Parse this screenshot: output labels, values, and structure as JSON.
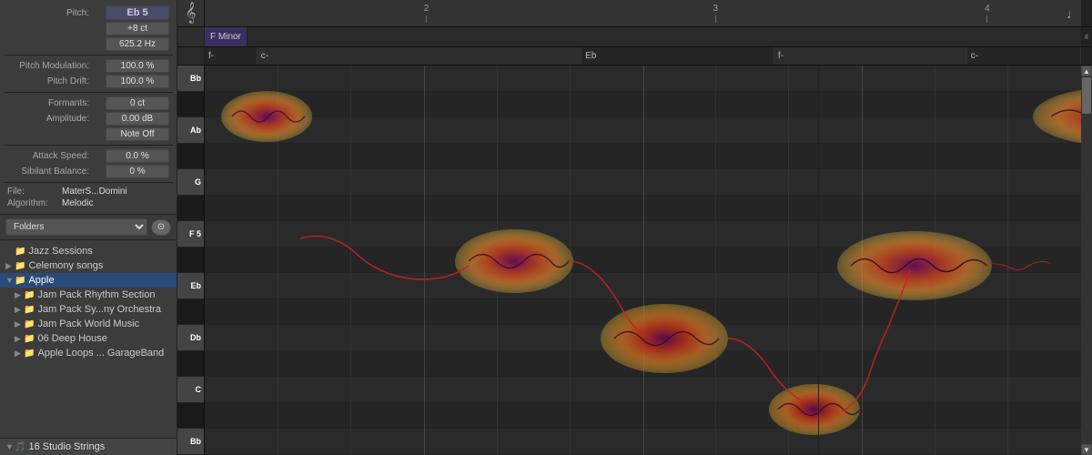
{
  "leftPanel": {
    "pitch_label": "Pitch:",
    "pitch_value": "Eb 5",
    "pitch_cents": "+8 ct",
    "pitch_hz": "625.2 Hz",
    "pitch_mod_label": "Pitch Modulation:",
    "pitch_mod_value": "100.0 %",
    "pitch_drift_label": "Pitch Drift:",
    "pitch_drift_value": "100.0 %",
    "formants_label": "Formants:",
    "formants_value": "0 ct",
    "amplitude_label": "Amplitude:",
    "amplitude_value": "0.00 dB",
    "note_off_label": "Note Off",
    "attack_speed_label": "Attack Speed:",
    "attack_speed_value": "0.0 %",
    "sibilant_balance_label": "Sibilant Balance:",
    "sibilant_balance_value": "0 %",
    "file_label": "File:",
    "file_value": "MaterS...Domini",
    "algorithm_label": "Algorithm:",
    "algorithm_value": "Melodic",
    "browser_select": "Folders",
    "tree": [
      {
        "label": "Jazz Sessions",
        "indent": 0,
        "arrow": "",
        "hasArrow": false,
        "selected": false
      },
      {
        "label": "Celemony songs",
        "indent": 0,
        "arrow": "▶",
        "hasArrow": true,
        "selected": false
      },
      {
        "label": "Apple",
        "indent": 0,
        "arrow": "▼",
        "hasArrow": true,
        "selected": true
      },
      {
        "label": "Jam Pack Rhythm Section",
        "indent": 1,
        "arrow": "▶",
        "hasArrow": true,
        "selected": false
      },
      {
        "label": "Jam Pack Sy...ny Orchestra",
        "indent": 1,
        "arrow": "▶",
        "hasArrow": true,
        "selected": false
      },
      {
        "label": "Jam Pack World Music",
        "indent": 1,
        "arrow": "▶",
        "hasArrow": true,
        "selected": false
      },
      {
        "label": "06 Deep House",
        "indent": 1,
        "arrow": "▶",
        "hasArrow": true,
        "selected": false
      },
      {
        "label": "Apple Loops ... GarageBand",
        "indent": 1,
        "arrow": "▶",
        "hasArrow": true,
        "selected": false
      }
    ],
    "bottom_item": "16 Studio Strings"
  },
  "editor": {
    "key_label": "F Minor",
    "ruler_marks": [
      "2",
      "3",
      "4"
    ],
    "chords": [
      "f-",
      "c-",
      "Eb",
      "f-",
      "c-"
    ],
    "piano_notes": [
      {
        "label": "Bb",
        "type": "white"
      },
      {
        "label": "",
        "type": "black"
      },
      {
        "label": "Ab",
        "type": "white"
      },
      {
        "label": "",
        "type": "black"
      },
      {
        "label": "G",
        "type": "white"
      },
      {
        "label": "",
        "type": "black"
      },
      {
        "label": "F 5",
        "type": "white",
        "labeled": true
      },
      {
        "label": "",
        "type": "black"
      },
      {
        "label": "Eb",
        "type": "white"
      },
      {
        "label": "",
        "type": "black"
      },
      {
        "label": "Db",
        "type": "white"
      },
      {
        "label": "",
        "type": "black"
      },
      {
        "label": "C",
        "type": "white"
      },
      {
        "label": "",
        "type": "black"
      },
      {
        "label": "Bb",
        "type": "white"
      }
    ]
  }
}
